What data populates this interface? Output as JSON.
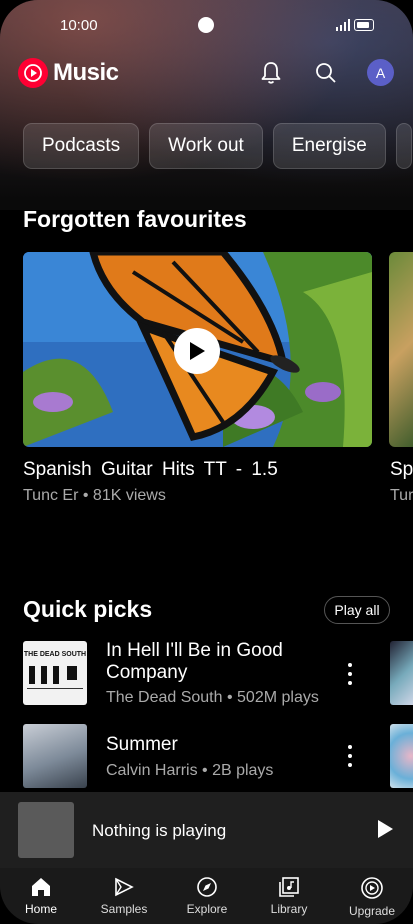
{
  "status": {
    "time": "10:00"
  },
  "header": {
    "brand": "Music"
  },
  "chips": [
    "Podcasts",
    "Work out",
    "Energise",
    ""
  ],
  "forgotten": {
    "title": "Forgotten favourites",
    "card": {
      "title": "Spanish  Guitar  Hits  TT - 1.5",
      "subtitle": "Tunc Er • 81K views"
    },
    "peek": {
      "title": "Sp",
      "subtitle": "Tur"
    }
  },
  "quick_picks": {
    "title": "Quick picks",
    "play_all": "Play all",
    "items": [
      {
        "title": "In Hell I'll Be in Good Company",
        "subtitle": "The Dead South • 502M plays",
        "art_text": "THE DEAD SOUTH"
      },
      {
        "title": "Summer",
        "subtitle": "Calvin Harris • 2B plays",
        "art_text": ""
      }
    ]
  },
  "mini_player": {
    "text": "Nothing is playing"
  },
  "nav": [
    "Home",
    "Samples",
    "Explore",
    "Library",
    "Upgrade"
  ],
  "avatar_letter": "A"
}
